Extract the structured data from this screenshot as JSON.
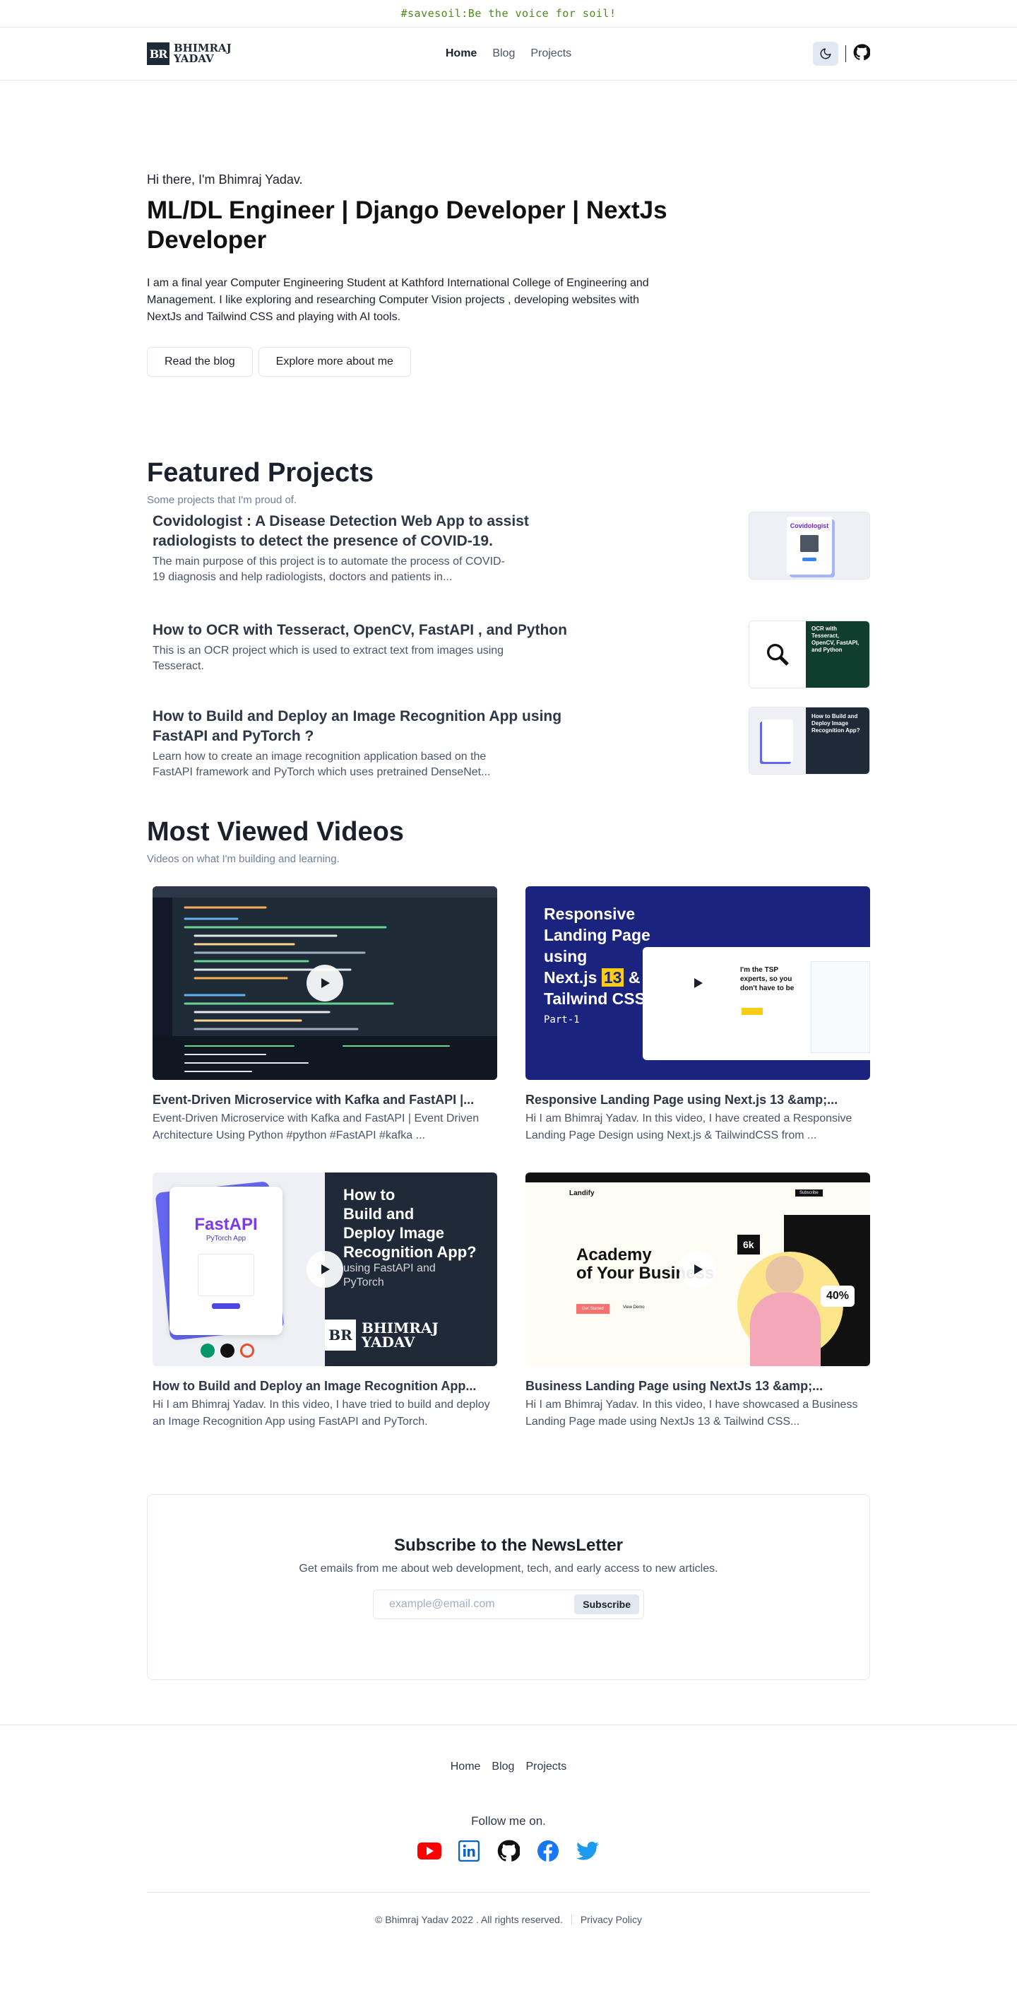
{
  "banner": "#savesoil:Be the voice for soil!",
  "logo": {
    "mark": "BR",
    "line1": "BHIMRAJ",
    "line2": "YADAV"
  },
  "nav": {
    "items": [
      {
        "label": "Home"
      },
      {
        "label": "Blog"
      },
      {
        "label": "Projects"
      }
    ]
  },
  "icons": {
    "theme": "moon-icon",
    "github": "github-icon"
  },
  "hero": {
    "greeting": "Hi there, I'm Bhimraj Yadav.",
    "title": "ML/DL Engineer | Django Developer | NextJs Developer",
    "description": "I am a final year Computer Engineering Student at Kathford International College of Engineering and Management. I like exploring and researching Computer Vision projects , developing websites with NextJs and Tailwind CSS and playing with AI tools.",
    "primary_button": "Read the blog",
    "secondary_button": "Explore more about me"
  },
  "featured": {
    "title": "Featured Projects",
    "subtitle": "Some projects that I'm proud of.",
    "projects": [
      {
        "title": "Covidologist : A Disease Detection Web App to assist radiologists to detect the presence of COVID-19.",
        "description": "The main purpose of this project is to automate the process of COVID-19 diagnosis and help radiologists, doctors and patients in...",
        "thumb_title": "Covidologist"
      },
      {
        "title": "How to OCR with Tesseract, OpenCV, FastAPI , and Python",
        "description": "This is an OCR project which is used to extract text from images using Tesseract.",
        "thumb_title": "OCR with Tesseract, OpenCV, FastAPI, and Python"
      },
      {
        "title": "How to Build and Deploy an Image Recognition App using FastAPI and PyTorch ?",
        "description": "Learn how to create an image recognition application based on the FastAPI framework and PyTorch which uses pretrained DenseNet...",
        "thumb_title": "How to Build and Deploy Image Recognition App?"
      }
    ]
  },
  "videos": {
    "title": "Most Viewed Videos",
    "subtitle": "Videos on what I'm building and learning.",
    "items": [
      {
        "title": "Event-Driven Microservice with Kafka and FastAPI |...",
        "description": "Event-Driven Microservice with Kafka and FastAPI | Event Driven Architecture Using Python #python #FastAPI #kafka ..."
      },
      {
        "title": "Responsive Landing Page using Next.js 13 &amp;...",
        "description": "Hi I am Bhimraj Yadav. In this video, I have created a Responsive Landing Page Design using Next.js & TailwindCSS from ...",
        "thumb": {
          "l1": "Responsive",
          "l2": "Landing Page",
          "l3": "using",
          "l4a": "Next.js",
          "l4b": "13",
          "l4c": "&",
          "l5": "Tailwind CSS",
          "l6": "Part-1",
          "mock": "I'm the TSP experts, so you don't have to be"
        }
      },
      {
        "title": "How to Build and Deploy an Image Recognition App...",
        "description": "Hi I am Bhimraj Yadav. In this video, I have tried to build and deploy an Image Recognition App using FastAPI and PyTorch.",
        "thumb": {
          "card_title": "FastAPI",
          "card_sub": "PyTorch App",
          "l1": "How to",
          "l2": "Build and",
          "l3": "Deploy Image",
          "l4": "Recognition App?",
          "l5": "using FastAPI and",
          "l6": "PyTorch",
          "brand1": "BHIMRAJ",
          "brand2": "YADAV"
        }
      },
      {
        "title": "Business Landing Page using NextJs 13 &amp;...",
        "description": "Hi I am Bhimraj Yadav. In this video, I have showcased a Business Landing Page made using NextJs 13 & Tailwind CSS...",
        "thumb": {
          "brand": "Landify",
          "h1": "Academy",
          "h2": "of Your Business",
          "badge1": "6k",
          "badge2": "40%",
          "cta": "Get Started",
          "sec": "View Demo",
          "nav_btn": "Subscribe"
        }
      }
    ]
  },
  "newsletter": {
    "title": "Subscribe to the NewsLetter",
    "subtitle": "Get emails from me about web development, tech, and early access to new articles.",
    "placeholder": "example@email.com",
    "button": "Subscribe"
  },
  "footer": {
    "links": [
      {
        "label": "Home"
      },
      {
        "label": "Blog"
      },
      {
        "label": "Projects"
      }
    ],
    "follow": "Follow me on.",
    "socials": [
      "youtube-icon",
      "linkedin-icon",
      "github-icon",
      "facebook-icon",
      "twitter-icon"
    ],
    "copyright": "© Bhimraj Yadav 2022 . All rights reserved.",
    "privacy": "Privacy Policy"
  },
  "colors": {
    "banner_text": "#4e8a1c",
    "youtube": "#ff0000",
    "linkedin": "#0a66c2",
    "facebook": "#1877f2",
    "twitter": "#1d9bf0"
  }
}
